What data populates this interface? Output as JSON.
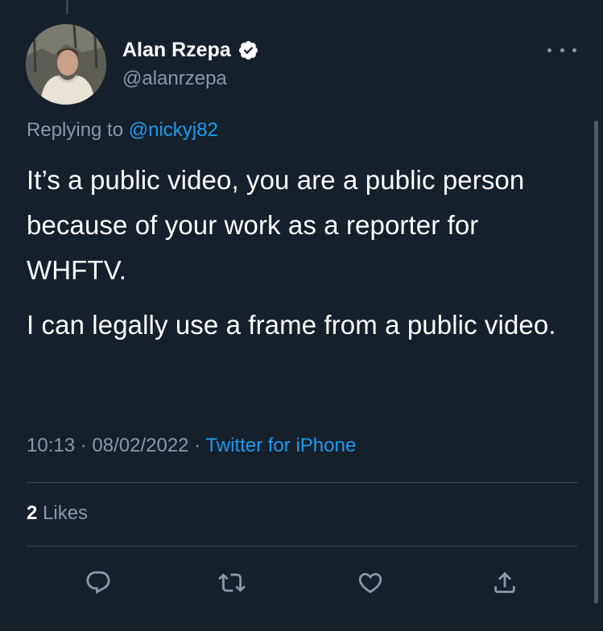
{
  "author": {
    "name": "Alan Rzepa",
    "handle": "@alanrzepa",
    "verified": true
  },
  "reply": {
    "prefix": "Replying to ",
    "to": "@nickyj82"
  },
  "tweet": {
    "paragraphs": [
      "It’s a public video, you are a public person because of your work as a reporter for WHFTV.",
      "I can legally use a frame from a public video."
    ]
  },
  "meta": {
    "time": "10:13",
    "date": "08/02/2022",
    "separator": " · ",
    "source": "Twitter for iPhone"
  },
  "stats": {
    "likes_count": "2",
    "likes_label": "Likes"
  },
  "colors": {
    "background": "#15202b",
    "accent": "#1d9bf0",
    "muted": "#8b98a5",
    "divider": "#38444d"
  },
  "icons": {
    "more": "more-horizontal-icon",
    "verified": "verified-badge-icon",
    "reply": "reply-icon",
    "retweet": "retweet-icon",
    "like": "heart-icon",
    "share": "share-icon"
  }
}
